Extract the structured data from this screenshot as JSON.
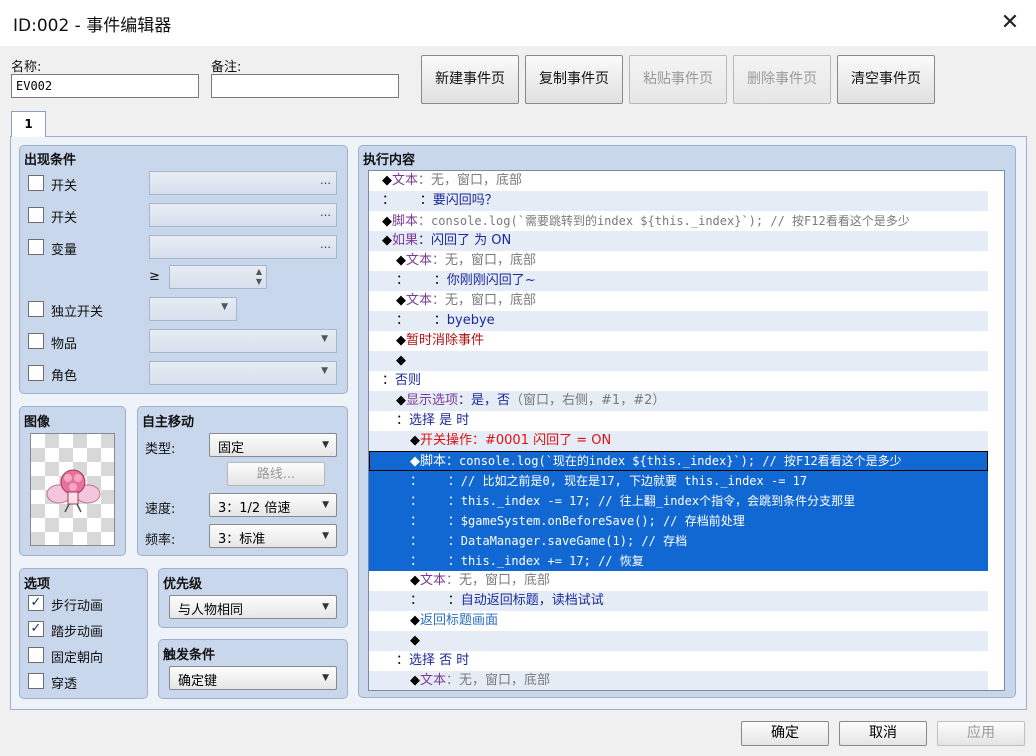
{
  "window": {
    "title": "ID:002 - 事件编辑器"
  },
  "header": {
    "name_label": "名称:",
    "name_value": "EV002",
    "note_label": "备注:",
    "note_value": "",
    "buttons": [
      {
        "label": "新建事件页",
        "enabled": true
      },
      {
        "label": "复制事件页",
        "enabled": true
      },
      {
        "label": "粘贴事件页",
        "enabled": false
      },
      {
        "label": "删除事件页",
        "enabled": false
      },
      {
        "label": "清空事件页",
        "enabled": true
      }
    ]
  },
  "tabs": [
    {
      "label": "1",
      "active": true
    }
  ],
  "conditions": {
    "title": "出现条件",
    "switch1": "开关",
    "switch2": "开关",
    "variable": "变量",
    "ge": "≥",
    "self_switch": "独立开关",
    "item": "物品",
    "actor": "角色",
    "ellipsis": "…"
  },
  "image": {
    "title": "图像"
  },
  "autonomous": {
    "title": "自主移动",
    "type_label": "类型:",
    "type_value": "固定",
    "route_button": "路线...",
    "speed_label": "速度:",
    "speed_value": "3：1/2 倍速",
    "freq_label": "频率:",
    "freq_value": "3：标准"
  },
  "options": {
    "title": "选项",
    "items": [
      {
        "label": "步行动画",
        "checked": true
      },
      {
        "label": "踏步动画",
        "checked": true
      },
      {
        "label": "固定朝向",
        "checked": false
      },
      {
        "label": "穿透",
        "checked": false
      }
    ]
  },
  "priority": {
    "title": "优先级",
    "value": "与人物相同"
  },
  "trigger": {
    "title": "触发条件",
    "value": "确定键"
  },
  "contents": {
    "title": "执行内容",
    "rows": [
      {
        "indent": 0,
        "parts": [
          [
            "◆",
            "k"
          ],
          [
            "文本",
            "purple"
          ],
          [
            "：无，窗口，底部",
            "gray"
          ]
        ]
      },
      {
        "indent": 0,
        "parts": [
          [
            "：      ：",
            ""
          ],
          [
            "要闪回吗？",
            "blue"
          ]
        ]
      },
      {
        "indent": 0,
        "parts": [
          [
            "◆",
            "k"
          ],
          [
            "脚本",
            "purple"
          ],
          [
            "：",
            "gray"
          ],
          [
            "console.log(`需要跳转到的index ${this._index}`); // 按F12看看这个是多少",
            "graymono"
          ]
        ]
      },
      {
        "indent": 0,
        "parts": [
          [
            "◆",
            "k"
          ],
          [
            "如果",
            "purple"
          ],
          [
            "：闪回了 为 ON",
            "blue"
          ]
        ]
      },
      {
        "indent": 1,
        "parts": [
          [
            "◆",
            "k"
          ],
          [
            "文本",
            "purple"
          ],
          [
            "：无，窗口，底部",
            "gray"
          ]
        ]
      },
      {
        "indent": 1,
        "parts": [
          [
            "：      ：",
            ""
          ],
          [
            "你刚刚闪回了~",
            "blue"
          ]
        ]
      },
      {
        "indent": 1,
        "parts": [
          [
            "◆",
            "k"
          ],
          [
            "文本",
            "purple"
          ],
          [
            "：无，窗口，底部",
            "gray"
          ]
        ]
      },
      {
        "indent": 1,
        "parts": [
          [
            "：      ：",
            ""
          ],
          [
            "byebye",
            "blue"
          ]
        ]
      },
      {
        "indent": 1,
        "parts": [
          [
            "◆",
            "k"
          ],
          [
            "暂时消除事件",
            "red"
          ]
        ]
      },
      {
        "indent": 1,
        "parts": [
          [
            "◆",
            "k"
          ]
        ]
      },
      {
        "indent": 0,
        "parts": [
          [
            "：",
            ""
          ],
          [
            "否则",
            "blue"
          ]
        ]
      },
      {
        "indent": 1,
        "parts": [
          [
            "◆",
            "k"
          ],
          [
            "显示选项",
            "purple"
          ],
          [
            "：是，否",
            "blue"
          ],
          [
            "（窗口，右侧，#1，#2）",
            "gray"
          ]
        ]
      },
      {
        "indent": 1,
        "parts": [
          [
            "：",
            ""
          ],
          [
            "选择 是 时",
            "blue"
          ]
        ]
      },
      {
        "indent": 2,
        "parts": [
          [
            "◆",
            "k"
          ],
          [
            "开关操作：#0001 闪回了 = ON",
            "bred"
          ]
        ]
      },
      {
        "indent": 2,
        "sel": true,
        "first": true,
        "parts": [
          [
            "◆",
            "k"
          ],
          [
            "脚本：",
            "purple"
          ],
          [
            "console.log(`现在的index ${this._index}`); // 按F12看看这个是多少",
            "mono"
          ]
        ]
      },
      {
        "indent": 2,
        "sel": true,
        "parts": [
          [
            "：      ：",
            ""
          ],
          [
            "// 比如之前是0, 现在是17, 下边就要 this._index -= 17",
            "mono"
          ]
        ]
      },
      {
        "indent": 2,
        "sel": true,
        "parts": [
          [
            "：      ：",
            ""
          ],
          [
            "this._index -= 17; // 往上翻_index个指令，会跳到条件分支那里",
            "mono"
          ]
        ]
      },
      {
        "indent": 2,
        "sel": true,
        "parts": [
          [
            "：      ：",
            ""
          ],
          [
            "$gameSystem.onBeforeSave(); // 存档前处理",
            "mono"
          ]
        ]
      },
      {
        "indent": 2,
        "sel": true,
        "parts": [
          [
            "：      ：",
            ""
          ],
          [
            "DataManager.saveGame(1); // 存档",
            "mono"
          ]
        ]
      },
      {
        "indent": 2,
        "sel": true,
        "parts": [
          [
            "：      ：",
            ""
          ],
          [
            "this._index += 17; // 恢复",
            "mono"
          ]
        ]
      },
      {
        "indent": 2,
        "parts": [
          [
            "◆",
            "k"
          ],
          [
            "文本",
            "purple"
          ],
          [
            "：无，窗口，底部",
            "gray"
          ]
        ]
      },
      {
        "indent": 2,
        "parts": [
          [
            "：      ：",
            ""
          ],
          [
            "自动返回标题，读档试试",
            "blue"
          ]
        ]
      },
      {
        "indent": 2,
        "parts": [
          [
            "◆",
            "k"
          ],
          [
            "返回标题画面",
            "teal"
          ]
        ]
      },
      {
        "indent": 2,
        "parts": [
          [
            "◆",
            "k"
          ]
        ]
      },
      {
        "indent": 1,
        "parts": [
          [
            "：",
            ""
          ],
          [
            "选择 否 时",
            "blue"
          ]
        ]
      },
      {
        "indent": 2,
        "parts": [
          [
            "◆",
            "k"
          ],
          [
            "文本",
            "purple"
          ],
          [
            "：无，窗口，底部",
            "gray"
          ]
        ]
      }
    ]
  },
  "footer": {
    "ok": "确定",
    "cancel": "取消",
    "apply": "应用"
  },
  "colors": {
    "selection": "#1268d3",
    "group_bg": "#c9d7ec",
    "panel_bg": "#eef3fa"
  }
}
